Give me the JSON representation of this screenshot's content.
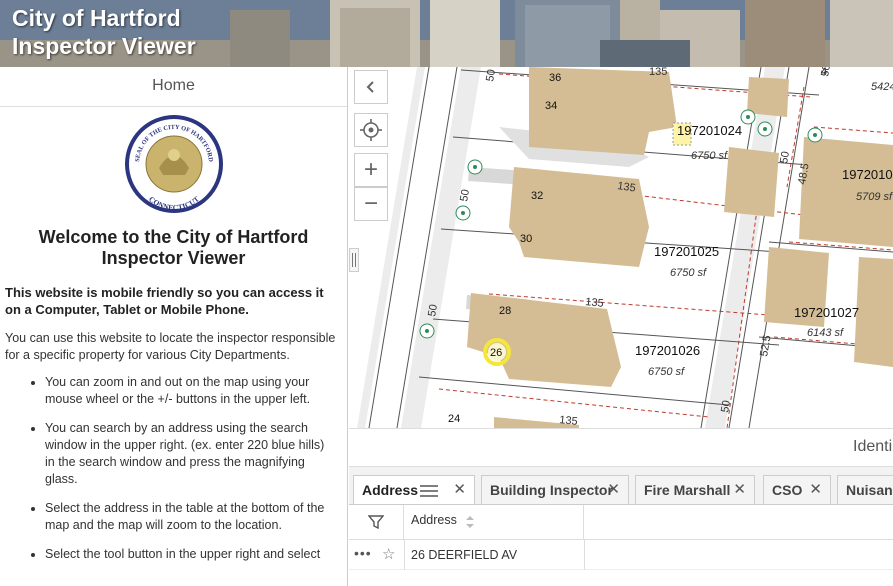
{
  "app": {
    "title_line1": "City of Hartford",
    "title_line2": "Inspector Viewer"
  },
  "sidebar": {
    "home_tab": "Home",
    "seal": {
      "top_text": "SEAL OF THE CITY OF HARTFORD",
      "bottom_text": "CONNECTICUT"
    },
    "welcome_line1": "Welcome to the City of Hartford",
    "welcome_line2": "Inspector Viewer",
    "intro_bold": "This website is mobile friendly so you can access it on a Computer, Tablet or Mobile Phone.",
    "intro": "You can use this website to locate the inspector responsible for a specific property for various City Departments.",
    "bullets": [
      "You can zoom in and out on the map using your mouse wheel or the +/- buttons in the upper left.",
      "You can search by an address using the search window in the upper right. (ex. enter 220 blue hills) in the search window and press the magnifying glass.",
      "Select the address in the table at the bottom of the map and the map will zoom to the location.",
      "Select the tool button in the upper right and select"
    ]
  },
  "map": {
    "controls": {
      "collapse_icon": "chevron-left-icon",
      "locate_icon": "crosshair-icon",
      "zoom_in": "+",
      "zoom_out": "−",
      "splitter_icon": "splitter-icon"
    },
    "labels": {
      "house_numbers": [
        "36",
        "34",
        "32",
        "30",
        "28",
        "26",
        "24"
      ],
      "parcels": [
        {
          "id": "197201024",
          "area": "6750 sf"
        },
        {
          "id": "197201025",
          "area": "6750 sf"
        },
        {
          "id": "197201026",
          "area": "6750 sf"
        },
        {
          "id": "197201027",
          "area": "6143 sf"
        },
        {
          "id": "1972010",
          "area": "5709 sf"
        },
        {
          "id": "5424",
          "area": ""
        },
        {
          "id": "4",
          "area": ""
        }
      ],
      "street_dims": [
        "135",
        "135",
        "135",
        "135",
        "50",
        "50",
        "50",
        "50",
        "50",
        "50",
        "48.5",
        "52.5"
      ],
      "highlighted_number": "26"
    }
  },
  "identify": {
    "label": "Identi"
  },
  "tabs": [
    {
      "label": "Address",
      "active": true
    },
    {
      "label": "Building Inspector",
      "active": false
    },
    {
      "label": "Fire Marshall",
      "active": false
    },
    {
      "label": "CSO",
      "active": false
    },
    {
      "label": "Nuisanc",
      "active": false
    }
  ],
  "table": {
    "column_header": "Address",
    "rows": [
      {
        "address": "26 DEERFIELD AV"
      }
    ]
  },
  "colors": {
    "building": "#d4bd94",
    "parcel_line": "#c0392b",
    "highlight": "#f5e63b"
  }
}
